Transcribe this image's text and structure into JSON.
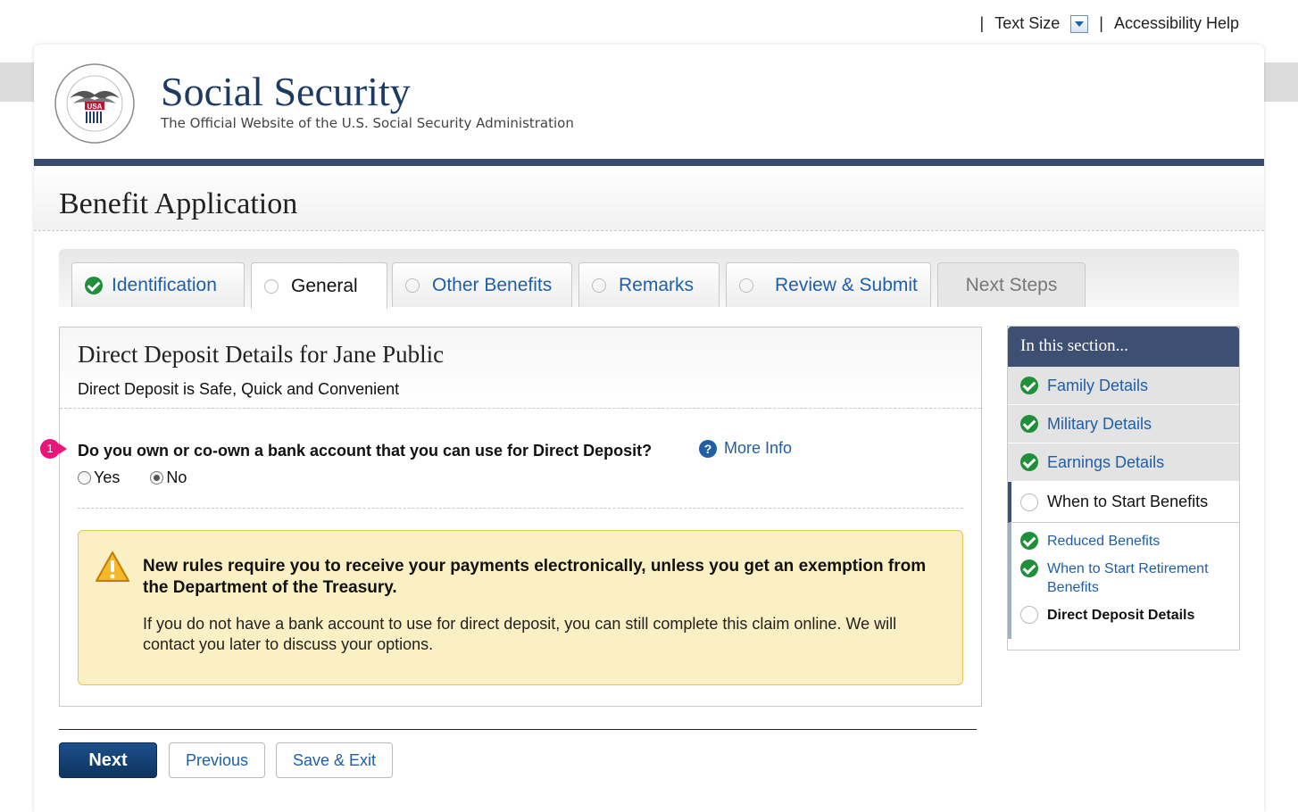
{
  "utility": {
    "sep1": "|",
    "text_size": "Text Size",
    "sep2": "|",
    "accessibility": "Accessibility Help"
  },
  "header": {
    "site_title": "Social Security",
    "site_subtitle": "The Official Website of the U.S. Social Security Administration",
    "seal_text": "SOCIAL SECURITY ADMINISTRATION USA"
  },
  "page": {
    "title": "Benefit Application"
  },
  "tabs": [
    {
      "label": "Identification",
      "state": "complete"
    },
    {
      "label": "General",
      "state": "active"
    },
    {
      "label": "Other Benefits",
      "state": "incomplete"
    },
    {
      "label": "Remarks",
      "state": "incomplete"
    },
    {
      "label": "Review & Submit",
      "state": "incomplete"
    },
    {
      "label": "Next Steps",
      "state": "disabled"
    }
  ],
  "panel": {
    "title": "Direct Deposit Details for Jane Public",
    "subtitle": "Direct Deposit is Safe, Quick and Convenient",
    "question_number": "1",
    "question": "Do you own or co-own a bank account that you can use for Direct Deposit?",
    "more_info": "More Info",
    "options": [
      {
        "label": "Yes",
        "selected": false
      },
      {
        "label": "No",
        "selected": true
      }
    ],
    "alert": {
      "heading": "New rules require you to receive your payments electronically, unless you get an exemption from the Department of the Treasury.",
      "body": "If you do not have a bank account to use for direct deposit, you can still complete this claim online. We will contact you later to discuss your options."
    }
  },
  "buttons": {
    "next": "Next",
    "previous": "Previous",
    "save_exit": "Save & Exit"
  },
  "sidebar": {
    "heading": "In this section...",
    "items": [
      {
        "label": "Family Details",
        "state": "complete"
      },
      {
        "label": "Military Details",
        "state": "complete"
      },
      {
        "label": "Earnings Details",
        "state": "complete"
      },
      {
        "label": "When to Start Benefits",
        "state": "current"
      }
    ],
    "subitems": [
      {
        "label": "Reduced Benefits",
        "state": "complete"
      },
      {
        "label": "When to Start Retirement Benefits",
        "state": "complete"
      },
      {
        "label": "Direct Deposit Details",
        "state": "current"
      }
    ]
  },
  "colors": {
    "navy": "#3a4a6b",
    "link_blue": "#1f5ea8",
    "check_green": "#1f8f3a",
    "alert_bg": "#fbf0c4",
    "marker_pink": "#e8157a"
  }
}
